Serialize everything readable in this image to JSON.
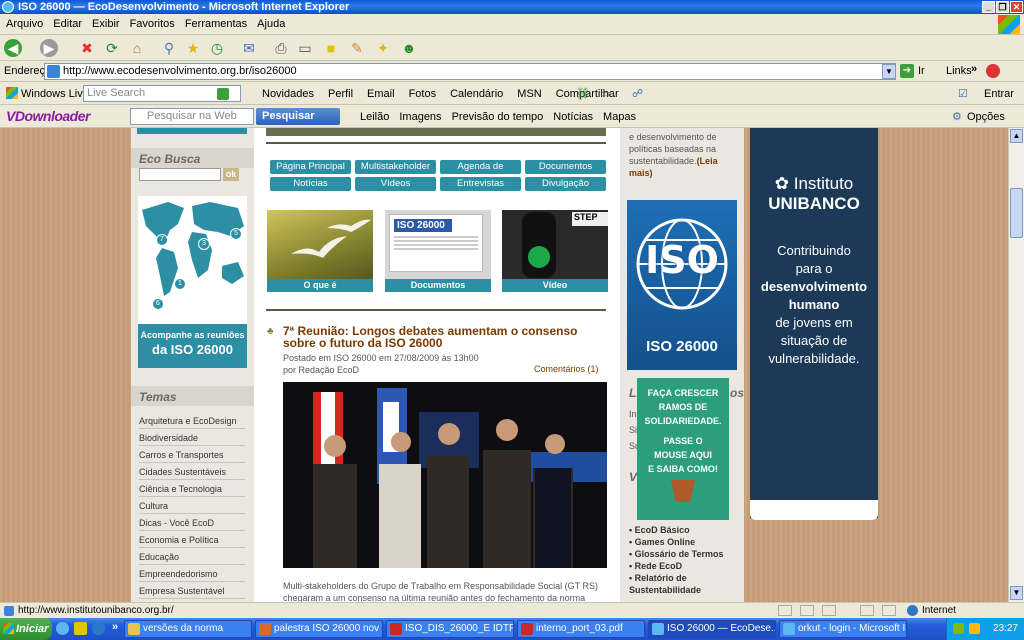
{
  "window": {
    "title": "ISO 26000 — EcoDesenvolvimento - Microsoft Internet Explorer"
  },
  "menu": [
    "Arquivo",
    "Editar",
    "Exibir",
    "Favoritos",
    "Ferramentas",
    "Ajuda"
  ],
  "address": {
    "label": "Endereço",
    "url": "http://www.ecodesenvolvimento.org.br/iso26000",
    "go": "Ir",
    "links": "Links"
  },
  "live_toolbar": {
    "brand": "Windows Live",
    "search_placeholder": "Live Search",
    "links": [
      "Novidades",
      "Perfil",
      "Email",
      "Fotos",
      "Calendário",
      "MSN",
      "Compartilhar"
    ],
    "signin": "Entrar"
  },
  "vd_toolbar": {
    "brand": "VDownloader",
    "search_placeholder": "Pesquisar na Web",
    "search_button": "Pesquisar",
    "links": [
      "Leilão",
      "Imagens",
      "Previsão do tempo",
      "Notícias",
      "Mapas"
    ],
    "options": "Opções"
  },
  "sidebar": {
    "eco_busca_title": "Eco Busca",
    "ok": "ok",
    "map_caption_1": "Acompanhe as reuniões",
    "map_caption_2": "da ISO 26000",
    "map_markers": [
      "7",
      "3",
      "5",
      "1",
      "6"
    ],
    "temas_title": "Temas",
    "temas": [
      "Arquitetura e EcoDesign",
      "Biodiversidade",
      "Carros e Transportes",
      "Cidades Sustentáveis",
      "Ciência e Tecnologia",
      "Cultura",
      "Dicas - Você EcoD",
      "Economia e Política",
      "Educação",
      "Empreendedorismo",
      "Empresa Sustentável"
    ]
  },
  "main": {
    "nav": [
      "Página Principal",
      "Multistakeholder",
      "Agenda de Reuniões",
      "Documentos",
      "Notícias",
      "Vídeos",
      "Entrevistas",
      "Divulgação"
    ],
    "thumbs": [
      "O que é",
      "Documentos",
      "Vídeo"
    ],
    "doc_thumb_label": "ISO 26000",
    "street_sign": "STEP",
    "article_title": "7ª Reunião: Longos debates aumentam o consenso sobre o futuro da ISO 26000",
    "article_posted": "Postado em ISO 26000 em 27/08/2009 às 13h00",
    "article_author": "por Redação EcoD",
    "comments": "Comentários (1)",
    "caption": "Multi-stakeholders do Grupo de Trabalho em Responsabilidade Social (GT RS) chegaram a um consenso na última reunião antes do fechamento da norma ISO"
  },
  "midcol": {
    "intro_lines": [
      "e desenvolvimento de",
      "políticas baseadas na",
      "sustentabilidade."
    ],
    "read_more": "(Leia mais)",
    "iso_logo": "ISO",
    "iso_label": "ISO 26000",
    "partial_header_1": "Li",
    "partial_header_2": "os",
    "partial_header_3": "Vo",
    "partial_items": [
      "Ins",
      "Si",
      "Su"
    ],
    "green_ad": [
      "FAÇA CRESCER",
      "RAMOS DE",
      "SOLIDARIEDADE.",
      "PASSE O",
      "MOUSE AQUI",
      "E SAIBA COMO!"
    ],
    "list": [
      "EcoD Básico",
      "Games Online",
      "Glossário de Termos",
      "Rede EcoD",
      "Relatório de Sustentabilidade"
    ]
  },
  "right_ad": {
    "brand_1": "Instituto",
    "brand_2": "UNIBANCO",
    "lines": [
      "Contribuindo",
      "para o",
      "desenvolvimento",
      "humano",
      "de jovens em",
      "situação de",
      "vulnerabilidade."
    ]
  },
  "status": {
    "url": "http://www.institutounibanco.org.br/",
    "zone": "Internet"
  },
  "taskbar": {
    "start": "Iniciar",
    "tasks": [
      "versões da norma",
      "palestra ISO 26000 nov ...",
      "ISO_DIS_26000_E IDTF...",
      "interno_port_03.pdf",
      "ISO 26000 — EcoDese...",
      "orkut - login - Microsoft I..."
    ],
    "clock": "23:27"
  },
  "colors": {
    "teal": "#2c8fa3",
    "article_brown": "#7a3a00",
    "unibanco_navy": "#1c3a57",
    "iso_blue": "#1e6fb5"
  }
}
